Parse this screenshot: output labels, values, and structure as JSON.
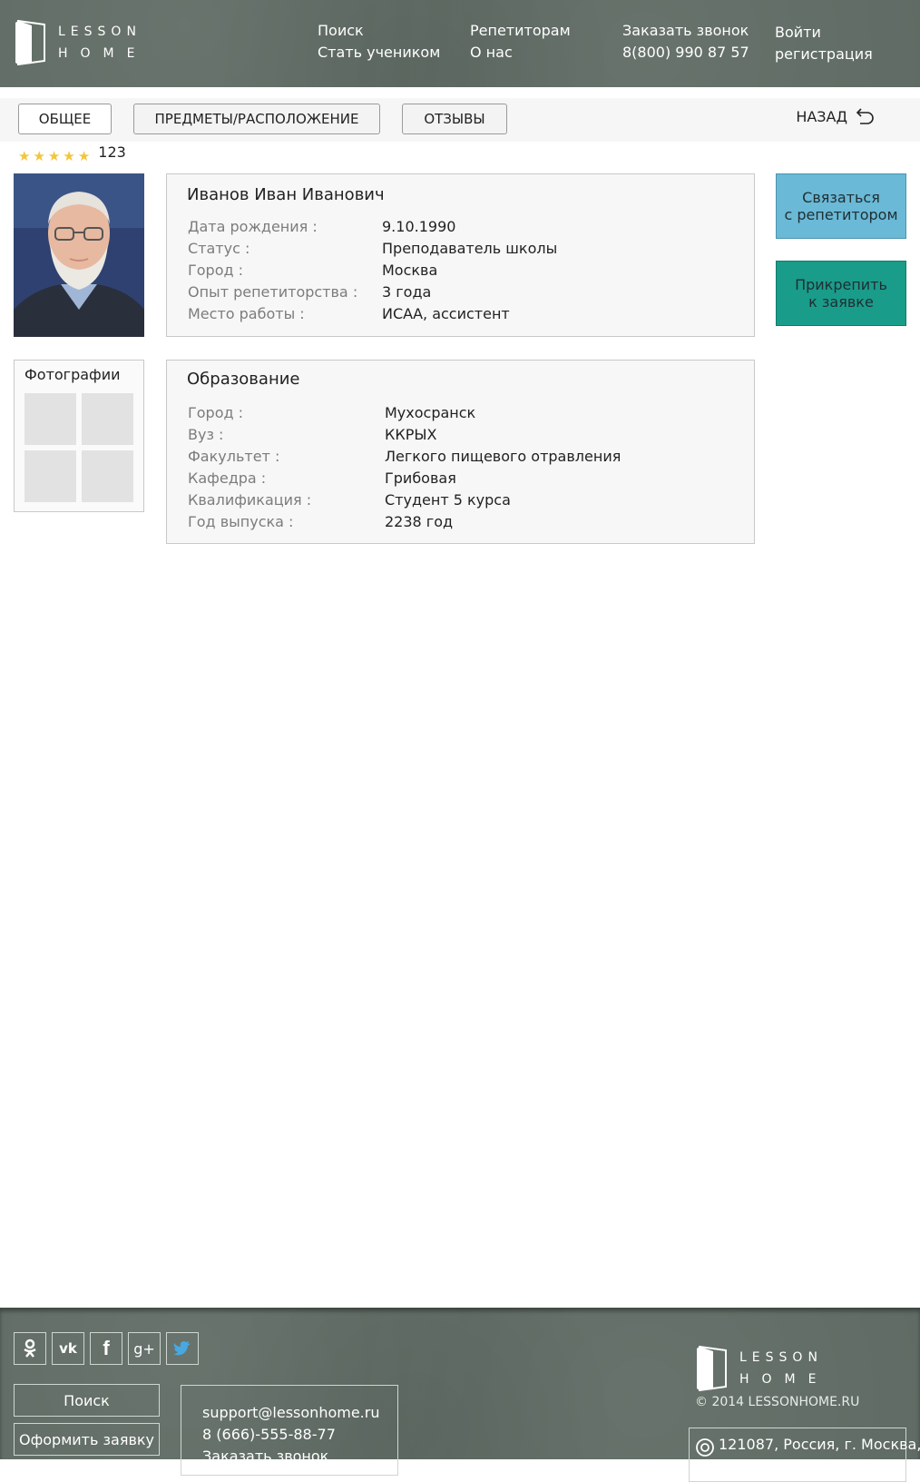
{
  "header": {
    "logo": {
      "line1": "LESSON",
      "line2": "HOME"
    },
    "nav": {
      "search": "Поиск",
      "become_student": "Стать учеником",
      "for_tutors": "Репетиторам",
      "about": "О нас",
      "order_call": "Заказать звонок",
      "phone": "8(800) 990 87 57",
      "login": "Войти",
      "register": "регистрация"
    }
  },
  "tabs": [
    {
      "label": "ОБЩЕЕ"
    },
    {
      "label": "ПРЕДМЕТЫ/РАСПОЛОЖЕНИЕ"
    },
    {
      "label": "ОТЗЫВЫ"
    }
  ],
  "back_label": "НАЗАД",
  "rating": {
    "stars": 5,
    "count": "123"
  },
  "profile": {
    "name": "Иванов Иван Иванович",
    "fields": [
      {
        "label": "Дата рождения :",
        "value": "9.10.1990"
      },
      {
        "label": "Статус :",
        "value": "Преподаватель школы"
      },
      {
        "label": "Город :",
        "value": "Москва"
      },
      {
        "label": "Опыт репетиторства :",
        "value": "3 года"
      },
      {
        "label": "Место работы :",
        "value": "ИСАА, ассистент"
      }
    ]
  },
  "education": {
    "title": "Образование",
    "fields": [
      {
        "label": "Город :",
        "value": "Мухосранск"
      },
      {
        "label": "Вуз :",
        "value": "ККРЫХ"
      },
      {
        "label": "Факультет :",
        "value": "Легкого пищевого отравления"
      },
      {
        "label": "Кафедра :",
        "value": "Грибовая"
      },
      {
        "label": "Квалификация :",
        "value": "Студент 5 курса"
      },
      {
        "label": "Год выпуска :",
        "value": "2238 год"
      }
    ]
  },
  "photos": {
    "title": "Фотографии"
  },
  "actions": {
    "contact_line1": "Связаться",
    "contact_line2": "с репетитором",
    "attach_line1": "Прикрепить",
    "attach_line2": "к заявке"
  },
  "footer": {
    "social_icons": [
      "odnoklassniki-icon",
      "vk-icon",
      "facebook-icon",
      "google-plus-icon",
      "twitter-icon"
    ],
    "buttons": {
      "search": "Поиск",
      "order": "Оформить заявку"
    },
    "contacts": {
      "email": "support@lessonhome.ru",
      "phone": "8 (666)-555-88-77",
      "order_call": "Заказать звонок"
    },
    "logo": {
      "line1": "LESSON",
      "line2": "HOME"
    },
    "copyright": "© 2014 LESSONHOME.RU",
    "address": "121087, Россия, г. Москва,"
  },
  "colors": {
    "header_bg": "#5f6b64",
    "contact_button": "#6ab9d6",
    "attach_button": "#1a9c8a",
    "star": "#f2c53d"
  }
}
